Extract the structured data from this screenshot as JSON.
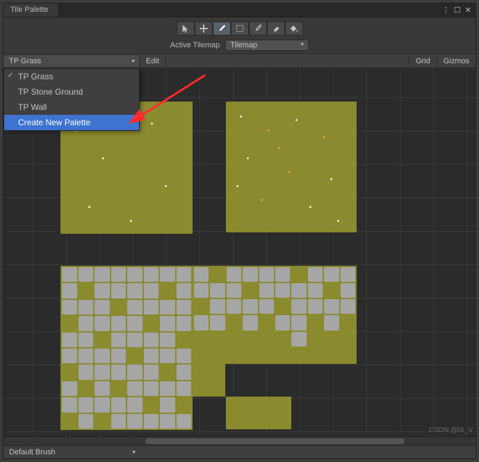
{
  "tabs": {
    "main": "Tile Palette"
  },
  "window_ctrls": {
    "menu": "⋮",
    "max": "☐",
    "close": "✕"
  },
  "toolbar": {
    "active_tilemap_label": "Active Tilemap",
    "tilemap_value": "Tilemap"
  },
  "subbar": {
    "palette_value": "TP Grass",
    "edit": "Edit",
    "grid": "Grid",
    "gizmos": "Gizmos"
  },
  "dropdown_menu": {
    "items": [
      "TP Grass",
      "TP Stone Ground",
      "TP Wall"
    ],
    "create_new": "Create New Palette"
  },
  "bottom": {
    "brush": "Default Brush"
  },
  "watermark": "CSDN @IX_V"
}
